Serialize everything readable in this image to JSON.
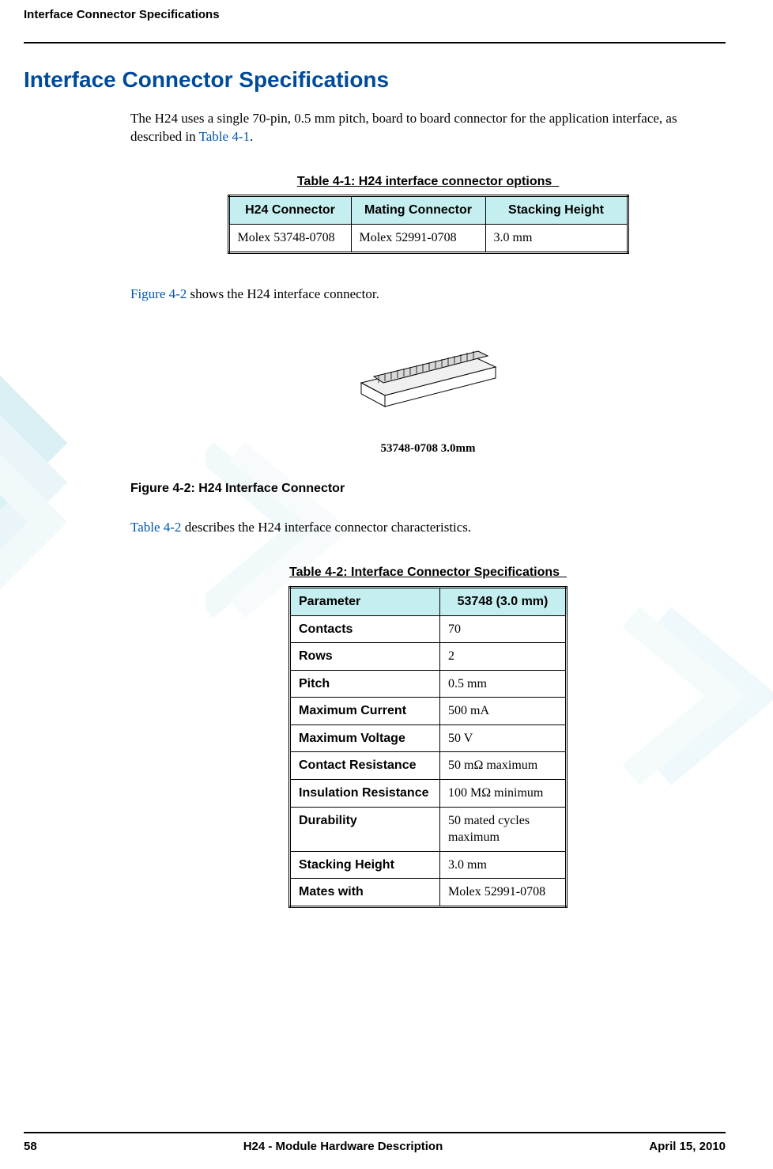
{
  "runningHeader": "Interface Connector Specifications",
  "title": "Interface Connector Specifications",
  "intro": {
    "pre": "The H24 uses a single 70-pin, 0.5 mm pitch, board to board connector for the application interface, as described in ",
    "xref": "Table 4-1",
    "post": "."
  },
  "table1": {
    "caption": "Table 4-1: H24 interface connector options",
    "headers": [
      "H24 Connector",
      "Mating Connector",
      "Stacking Height"
    ],
    "row": [
      "Molex 53748-0708",
      "Molex 52991-0708",
      "3.0 mm"
    ]
  },
  "midPara1": {
    "xref": "Figure 4-2",
    "post": " shows the H24 interface connector."
  },
  "figure": {
    "partLabel": "53748-0708 3.0mm",
    "caption": "Figure 4-2: H24 Interface Connector"
  },
  "midPara2": {
    "xref": "Table 4-2",
    "post": " describes the H24 interface connector characteristics."
  },
  "table2": {
    "caption": "Table 4-2: Interface Connector Specifications",
    "headers": [
      "Parameter",
      "53748 (3.0 mm)"
    ],
    "rows": [
      [
        "Contacts",
        "70"
      ],
      [
        "Rows",
        "2"
      ],
      [
        "Pitch",
        "0.5 mm"
      ],
      [
        "Maximum Current",
        "500 mA"
      ],
      [
        "Maximum Voltage",
        "50 V"
      ],
      [
        "Contact Resistance",
        "50 mΩ maximum"
      ],
      [
        "Insulation Resistance",
        "100 MΩ minimum"
      ],
      [
        "Durability",
        "50 mated cycles maximum"
      ],
      [
        "Stacking Height",
        "3.0 mm"
      ],
      [
        "Mates with",
        "Molex 52991-0708"
      ]
    ]
  },
  "footer": {
    "pageNum": "58",
    "docTitle": "H24 - Module Hardware Description",
    "date": "April 15, 2010"
  }
}
